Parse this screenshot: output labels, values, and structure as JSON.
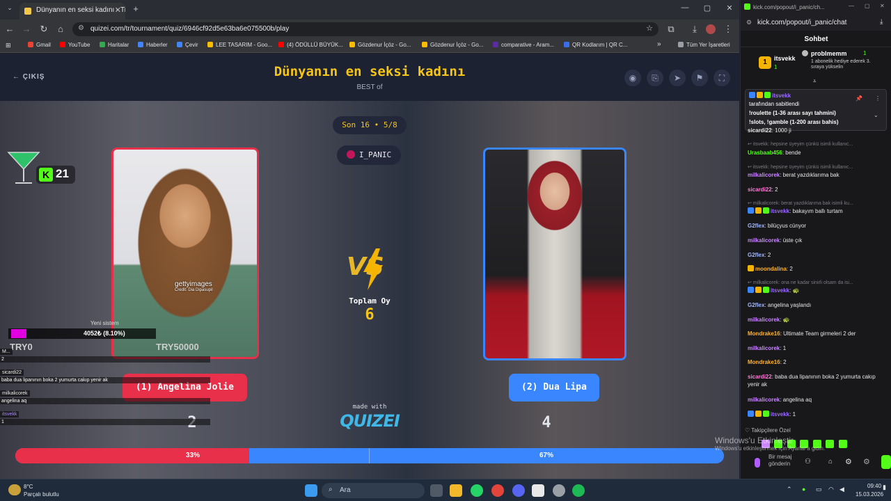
{
  "browser": {
    "tab_title": "Dünyanın en seksi kadını - Tier",
    "url": "quizei.com/tr/tournament/quiz/6946cf92d5e63ba6e075500b/play",
    "bookmarks": [
      "Gmail",
      "YouTube",
      "Haritalar",
      "Haberler",
      "Çevir",
      "LEE TASARIM - Goo...",
      "(4) ÖDÜLLÜ BÜYÜK...",
      "Gözdenur İçöz - Go...",
      "Gözdenur İçöz - Go...",
      "comparative - Aram...",
      "QR Kodlarım | QR C..."
    ],
    "all_bookmarks": "Tüm Yer İşaretleri"
  },
  "quiz": {
    "exit": "ÇIKIŞ",
    "title": "Dünyanın en seksi kadını",
    "subtitle": "BEST of",
    "round": "Son 16 • 5/8",
    "streamer": "I_PANIC",
    "left": {
      "name": "(1) Angelina Jolie",
      "votes": "2",
      "watermark": "gettyimages",
      "credit": "Credit: Dia Dipasupil"
    },
    "right": {
      "name": "(2) Dua Lipa",
      "votes": "4"
    },
    "total_label": "Toplam Oy",
    "total_value": "6",
    "made_with": "made with",
    "logo": "QUIZEI",
    "left_percent_label": "33%",
    "right_percent_label": "67%",
    "left_percent": 33
  },
  "overlay": {
    "kick_count": "21",
    "new_system": "Yeni sistem",
    "goal_text": "4052₺ (8.10%)",
    "goal_left": "TRY0",
    "goal_right": "TRY50000",
    "chat": [
      {
        "user": "M...",
        "text": "2"
      },
      {
        "user": "sicardi22",
        "text": "baba dua lipanının boka 2 yumurta cakıp yenir ak"
      },
      {
        "user": "milkalicorek",
        "text": "angelina aq"
      },
      {
        "user": "itsvekk",
        "text": "1"
      }
    ]
  },
  "popout": {
    "window_title": "kick.com/popout/i_panic/ch...",
    "url": "kick.com/popout/i_panic/chat",
    "header": "Sohbet",
    "gifter1": {
      "name": "itsvekk",
      "count": "1"
    },
    "gifter2": {
      "name": "probImemm",
      "count": "1",
      "note": "1 abonelik hediye ederek 3. sıraya yükselin"
    },
    "pinned": {
      "user": "itsvekk",
      "by": "tarafından sabitlendi",
      "line1": "!roulette (1-36 arası sayı tahmini)",
      "line2": "!slots, !gamble (1-200 arası bahis)"
    },
    "messages": [
      {
        "sys": false,
        "user": "sicardi22",
        "color": "#ffffff",
        "text": "1000 ji"
      },
      {
        "sys": true,
        "text": "itsvekk: hepsine üyeyim çünkü isimli kullanıc..."
      },
      {
        "sys": false,
        "user": "Urasbaab456",
        "color": "#53fc18",
        "text": "bende"
      },
      {
        "sys": true,
        "text": "itsvekk: hepsine üyeyim çünkü isimli kullanıc..."
      },
      {
        "sys": false,
        "user": "milkalicorek",
        "color": "#c986ff",
        "text": "berat yazdıklarıma bak"
      },
      {
        "sys": false,
        "user": "sicardi22",
        "color": "#ff7ad6",
        "text": "2"
      },
      {
        "sys": true,
        "text": "milkalicorek: berat yazdıklarıma bak isimli ku..."
      },
      {
        "sys": false,
        "user": "itsvekk",
        "color": "#9b6bff",
        "text": "bakayım ballı turtam"
      },
      {
        "sys": false,
        "user": "G2flex",
        "color": "#9fb7ff",
        "text": "bilüçyus cünyor"
      },
      {
        "sys": false,
        "user": "milkalicorek",
        "color": "#c986ff",
        "text": "üste çık"
      },
      {
        "sys": false,
        "user": "G2flex",
        "color": "#9fb7ff",
        "text": "2"
      },
      {
        "sys": false,
        "user": "moondalina",
        "color": "#ffb22e",
        "text": "2"
      },
      {
        "sys": true,
        "text": "milkalicorek: ona ne kadar sinirli olsam da isi..."
      },
      {
        "sys": false,
        "user": "itsvekk",
        "color": "#9b6bff",
        "text": "🐢"
      },
      {
        "sys": false,
        "user": "G2flex",
        "color": "#9fb7ff",
        "text": "angelina yaşlandı"
      },
      {
        "sys": false,
        "user": "milkalicorek",
        "color": "#c986ff",
        "text": "🐢"
      },
      {
        "sys": false,
        "user": "Mondrake16",
        "color": "#ffb22e",
        "text": "Ultimate Team girmeleri 2 der"
      },
      {
        "sys": false,
        "user": "milkalicorek",
        "color": "#c986ff",
        "text": "1"
      },
      {
        "sys": false,
        "user": "Mondrake16",
        "color": "#ffb22e",
        "text": "2"
      },
      {
        "sys": false,
        "user": "sicardi22",
        "color": "#ff7ad6",
        "text": "baba dua lipanının boka 2 yumurta cakıp yenir ak"
      },
      {
        "sys": false,
        "user": "milkalicorek",
        "color": "#c986ff",
        "text": "angelina aq"
      },
      {
        "sys": false,
        "user": "itsvekk",
        "color": "#9b6bff",
        "text": "1"
      }
    ],
    "followers_only": "Takipçilere Özel",
    "send_placeholder": "Bir mesaj gönderin"
  },
  "taskbar": {
    "weather_temp": "8°C",
    "weather_text": "Parçalı bulutlu",
    "search": "Ara",
    "time": "09:40",
    "date": "15.03.2026"
  },
  "windows_activation": {
    "line1": "Windows'u Etkinleştir",
    "line2": "Windows'u etkinleştirmek için Ayarlar'a gidin."
  }
}
